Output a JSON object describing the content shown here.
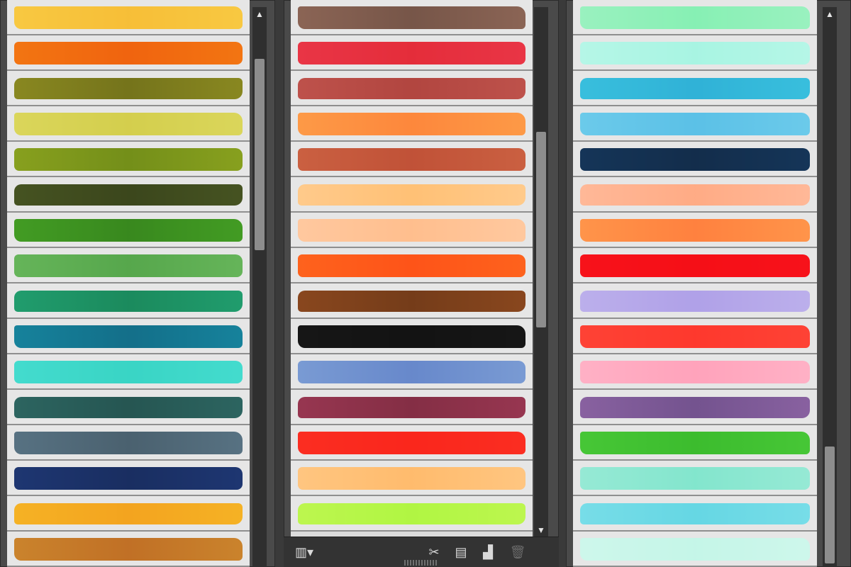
{
  "panels": [
    {
      "id": "p1",
      "scroll": {
        "thumb_top_percent": 0.07,
        "thumb_height_percent": 0.36
      },
      "swatches": [
        {
          "name": "yellow",
          "color": "#f6c23e"
        },
        {
          "name": "orange",
          "color": "#ef6a12"
        },
        {
          "name": "olive",
          "color": "#7c7b1f"
        },
        {
          "name": "pale yellow",
          "color": "#d6d154"
        },
        {
          "name": "yellow-green",
          "color": "#7b951d"
        },
        {
          "name": "dark olive",
          "color": "#3f4b1f"
        },
        {
          "name": "green",
          "color": "#3d8f22"
        },
        {
          "name": "light green",
          "color": "#5dac52"
        },
        {
          "name": "emerald",
          "color": "#1f9063"
        },
        {
          "name": "teal-blue",
          "color": "#16768f"
        },
        {
          "name": "aqua",
          "color": "#3fd6c8"
        },
        {
          "name": "dark teal",
          "color": "#295b57"
        },
        {
          "name": "slate",
          "color": "#4f6776"
        },
        {
          "name": "navy",
          "color": "#1b3166"
        },
        {
          "name": "golden",
          "color": "#f3a924"
        },
        {
          "name": "ochre",
          "color": "#c3772a"
        }
      ]
    },
    {
      "id": "p2",
      "scroll": {
        "thumb_top_percent": 0.22,
        "thumb_height_percent": 0.39
      },
      "swatches": [
        {
          "name": "brown-gray",
          "color": "#7d5b4d"
        },
        {
          "name": "crimson",
          "color": "#e3313f"
        },
        {
          "name": "brick",
          "color": "#b44a45"
        },
        {
          "name": "apricot",
          "color": "#fb8e42"
        },
        {
          "name": "rust",
          "color": "#c2573c"
        },
        {
          "name": "peach",
          "color": "#ffc47f"
        },
        {
          "name": "light peach",
          "color": "#ffc295"
        },
        {
          "name": "vermilion",
          "color": "#fb5a1c"
        },
        {
          "name": "chocolate",
          "color": "#7b401c"
        },
        {
          "name": "black",
          "color": "#141414"
        },
        {
          "name": "steel blue",
          "color": "#6f8fcd"
        },
        {
          "name": "maroon",
          "color": "#8a3149"
        },
        {
          "name": "red",
          "color": "#f72a1f"
        },
        {
          "name": "light orange",
          "color": "#ffbf76"
        },
        {
          "name": "lime",
          "color": "#b6f54a"
        }
      ]
    },
    {
      "id": "p3",
      "scroll": {
        "thumb_top_percent": 0.8,
        "thumb_height_percent": 0.22
      },
      "swatches": [
        {
          "name": "mint",
          "color": "#8ff0b9"
        },
        {
          "name": "pale aqua",
          "color": "#aef5e4"
        },
        {
          "name": "cyan",
          "color": "#35b6d8"
        },
        {
          "name": "sky",
          "color": "#63c4e7"
        },
        {
          "name": "navy dark",
          "color": "#14304f"
        },
        {
          "name": "salmon",
          "color": "#ffb08d"
        },
        {
          "name": "tangerine",
          "color": "#ff8845"
        },
        {
          "name": "red bright",
          "color": "#f21119"
        },
        {
          "name": "lavender",
          "color": "#b4a6e8"
        },
        {
          "name": "red-orange",
          "color": "#fb3d31"
        },
        {
          "name": "pink",
          "color": "#ffa8bf"
        },
        {
          "name": "plum",
          "color": "#7b5894"
        },
        {
          "name": "green bright",
          "color": "#42bf33"
        },
        {
          "name": "aquamarine",
          "color": "#8be7d0"
        },
        {
          "name": "turquoise",
          "color": "#6ed9e4"
        },
        {
          "name": "pale mint",
          "color": "#c9f6e9"
        }
      ]
    }
  ],
  "toolbar": {
    "icons": [
      {
        "name": "brush-library-menu-icon",
        "glyph": "▥▾"
      },
      {
        "name": "remove-brush-stroke-icon",
        "glyph": "✂"
      },
      {
        "name": "brush-options-icon",
        "glyph": "▤"
      },
      {
        "name": "new-brush-icon",
        "glyph": "▟"
      },
      {
        "name": "delete-brush-icon",
        "glyph": "🗑"
      }
    ]
  }
}
